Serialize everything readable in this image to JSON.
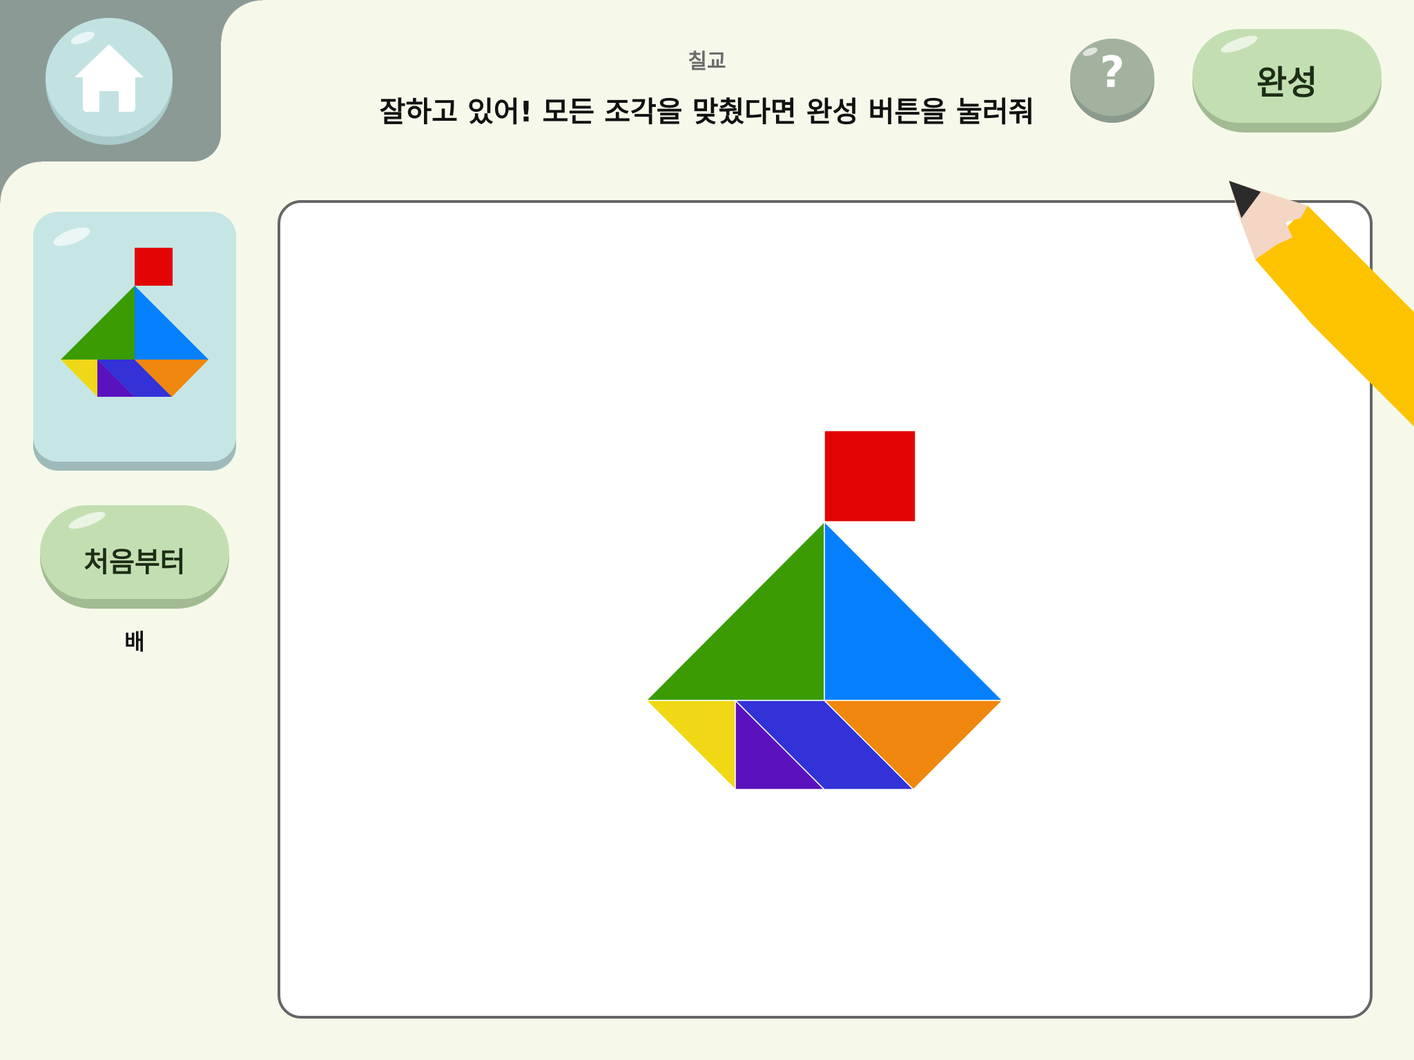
{
  "header": {
    "title": "칠교",
    "instruction": "잘하고 있어! 모든 조각을 맞췄다면 완성 버튼을 눌러줘"
  },
  "buttons": {
    "home_icon": "home-icon",
    "help_label": "?",
    "done_label": "완성",
    "reset_label": "처음부터"
  },
  "reference": {
    "label": "배"
  },
  "colors": {
    "background": "#f6f9ea",
    "red": "#e30505",
    "green": "#3a9c02",
    "blue": "#0480ff",
    "yellow": "#f0d816",
    "purple": "#5a12be",
    "indigo": "#3232d7",
    "orange": "#f0870f",
    "pencil": "#fdc300"
  }
}
